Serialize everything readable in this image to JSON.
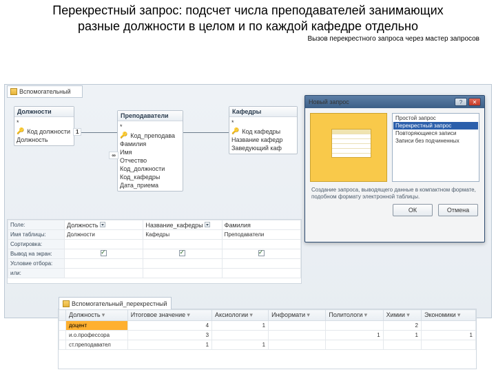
{
  "title": "Перекрестный запрос: подсчет числа преподавателей занимающих разные должности в целом и по каждой кафедре отдельно",
  "subtitle": "Вызов перекрестного запроса через мастер запросов",
  "design_window_tab": "Вспомогательный",
  "tables": {
    "t1": {
      "title": "Должности",
      "fields": [
        "*",
        "Код должности",
        "Должность"
      ],
      "key_index": 1
    },
    "t2": {
      "title": "Преподаватели",
      "fields": [
        "*",
        "Код_преподава",
        "Фамилия",
        "Имя",
        "Отчество",
        "Код_должности",
        "Код_кафедры",
        "Дата_приема"
      ],
      "key_index": 1
    },
    "t3": {
      "title": "Кафедры",
      "fields": [
        "*",
        "Код кафедры",
        "Название кафедр",
        "Заведующий каф"
      ],
      "key_index": 1
    }
  },
  "rel": {
    "left": "1",
    "right": "∞"
  },
  "grid": {
    "rows": [
      "Поле:",
      "Имя таблицы:",
      "Сортировка:",
      "Вывод на экран:",
      "Условие отбора:",
      "или:"
    ],
    "cols": [
      {
        "field": "Должность",
        "table": "Должности",
        "show": true
      },
      {
        "field": "Название_кафедры",
        "table": "Кафедры",
        "show": true
      },
      {
        "field": "Фамилия",
        "table": "Преподаватели",
        "show": true
      }
    ]
  },
  "dialog": {
    "title": "Новый запрос",
    "options": [
      "Простой запрос",
      "Перекрестный запрос",
      "Повторяющиеся записи",
      "Записи без подчиненных"
    ],
    "selected": 1,
    "desc": "Создание запроса, выводящего данные в компактном формате, подобном формату электронной таблицы.",
    "ok": "ОК",
    "cancel": "Отмена"
  },
  "result": {
    "tab": "Вспомогательный_перекрестный",
    "headers": [
      "Должность",
      "Итоговое значение",
      "Аксиологии",
      "Информати",
      "Политологи",
      "Химии",
      "Экономики"
    ],
    "rows": [
      [
        "доцент",
        "4",
        "1",
        "",
        "",
        "2",
        ""
      ],
      [
        "и.о.профессора",
        "3",
        "",
        "",
        "1",
        "1",
        "1"
      ],
      [
        "ст.преподавател",
        "1",
        "1",
        "",
        "",
        "",
        ""
      ]
    ]
  }
}
